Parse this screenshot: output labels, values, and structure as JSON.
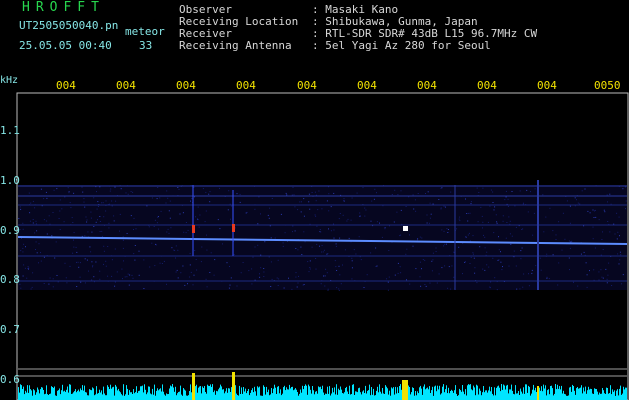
{
  "header": {
    "brand": "HROFFT",
    "filename": "UT2505050040.pn",
    "meteor_label": "meteor",
    "datetime": "25.05.05 00:40",
    "meteor_count": "33"
  },
  "meta": [
    {
      "key": "Observer",
      "value": ": Masaki Kano"
    },
    {
      "key": "Receiving Location",
      "value": ": Shibukawa, Gunma, Japan"
    },
    {
      "key": "Receiver",
      "value": ": RTL-SDR SDR# 43dB L15 96.7MHz CW"
    },
    {
      "key": "Receiving Antenna",
      "value": ": 5el Yagi Az 280 for Seoul"
    }
  ],
  "y_axis": {
    "unit": "kHz",
    "ticks": [
      "1.1",
      "1.0",
      "0.9",
      "0.8",
      "0.7",
      "0.6"
    ]
  },
  "x_axis": {
    "ticks": [
      "004",
      "004",
      "004",
      "004",
      "004",
      "004",
      "004",
      "004",
      "004",
      "0050"
    ]
  },
  "colors": {
    "header_green": "#27d64e",
    "header_cyan": "#86e6e6",
    "tick_yellow": "#f2e200",
    "noise_cyan": "#00e5ff",
    "echo_band_blue": "#3550ff"
  }
}
